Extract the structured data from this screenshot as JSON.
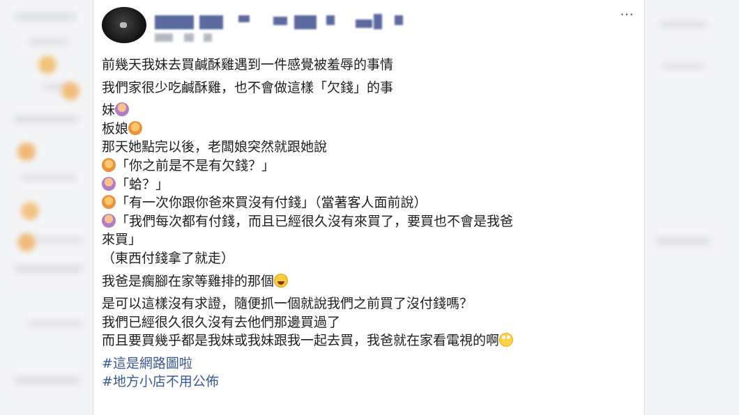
{
  "post": {
    "more_icon": "⋯",
    "lines": [
      "前幾天我妹去買鹹酥雞遇到一件感覺被羞辱的事情",
      "我們家很少吃鹹酥雞，也不會做這樣「欠錢」的事",
      "妹",
      "板娘",
      "那天她點完以後，老闆娘突然就跟她說",
      "「你之前是不是有欠錢？」",
      "「蛤？」",
      "「有一次你跟你爸來買沒有付錢」（當著客人面前說）",
      "「我們每次都有付錢，而且已經很久沒有來買了，要買也不會是我爸",
      "來買」",
      "（東西付錢拿了就走）",
      "我爸是瘸腳在家等雞排的那個",
      "是可以這樣沒有求證，隨便抓一個就說我們之前買了沒付錢嗎？",
      "我們已經很久很久沒有去他們那邊買過了",
      "而且要買幾乎都是我妹或我妹跟我一起去買，我爸就在家看電視的啊"
    ],
    "hashtags": [
      "#這是網路圖啦",
      "#地方小店不用公佈"
    ],
    "emoji_icons": {
      "sister": "woman-gesturing-no-icon",
      "boss_lady": "woman-face-icon",
      "laugh": "rolling-laughing-icon",
      "eyeroll": "face-rolling-eyes-icon"
    }
  }
}
